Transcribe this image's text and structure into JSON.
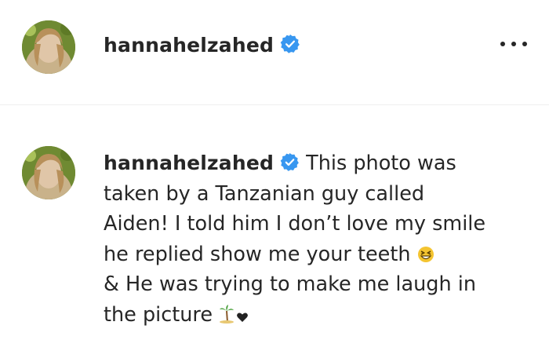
{
  "post": {
    "username": "hannahelzahed",
    "verified": true,
    "more_icon": "more-horizontal-icon"
  },
  "comment": {
    "username": "hannahelzahed",
    "verified": true,
    "text_lines": [
      "This photo was",
      "taken by a Tanzanian guy called",
      "Aiden! I told him I don’t love my smile",
      "he replied show me your teeth",
      "& He was trying to make me laugh in",
      "the picture"
    ],
    "emojis": [
      "grinning-squinting-face-emoji",
      "palm-tree-on-island-emoji",
      "black-heart-emoji"
    ]
  },
  "colors": {
    "verified_blue": "#3897f0",
    "text": "#262626",
    "divider": "#efefef"
  }
}
